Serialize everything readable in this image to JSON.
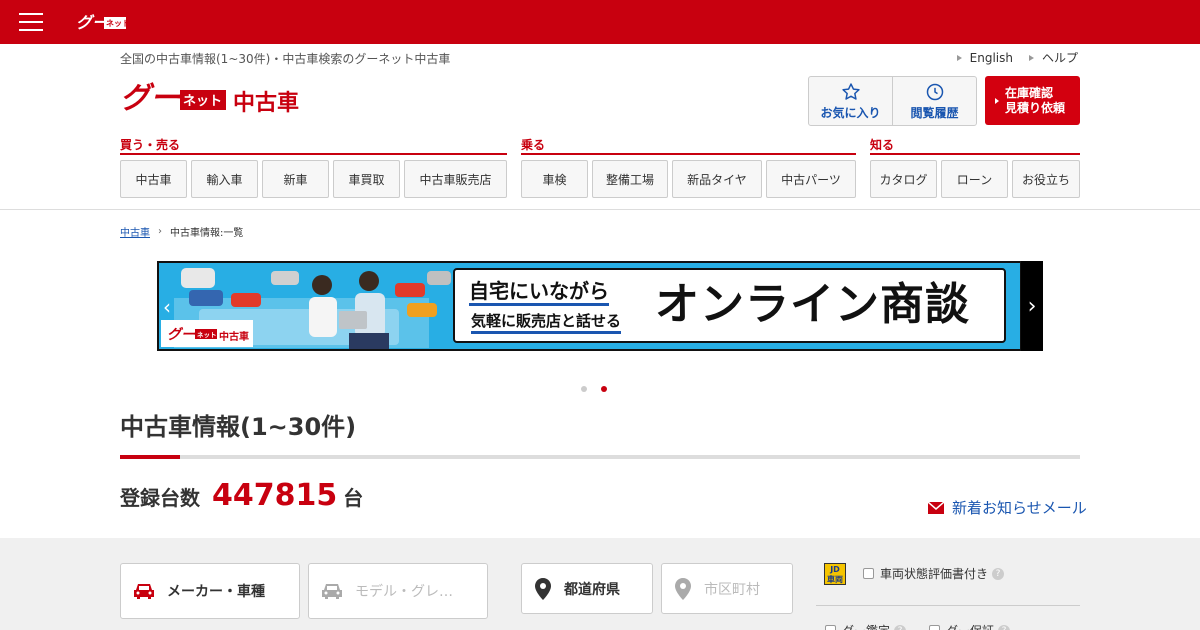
{
  "header": {
    "tagline": "全国の中古車情報(1~30件)・中古車検索のグーネット中古車",
    "links": [
      "English",
      "ヘルプ"
    ],
    "favorites_label": "お気に入り",
    "history_label": "閲覧履歴",
    "stock_line1": "在庫確認",
    "stock_line2": "見積り依頼",
    "logo_text": "グー",
    "logo_net": "ネット",
    "logo_sub": "中古車"
  },
  "nav": [
    {
      "title": "買う・売る",
      "items": [
        "中古車",
        "輸入車",
        "新車",
        "車買取",
        "中古車販売店"
      ]
    },
    {
      "title": "乗る",
      "items": [
        "車検",
        "整備工場",
        "新品タイヤ",
        "中古パーツ"
      ]
    },
    {
      "title": "知る",
      "items": [
        "カタログ",
        "ローン",
        "お役立ち"
      ]
    }
  ],
  "breadcrumb": {
    "home": "中古車",
    "current": "中古車情報:一覧"
  },
  "banner": {
    "sub1": "自宅にいながら",
    "sub2": "気軽に販売店と話せる",
    "main": "オンライン商談",
    "logo_sub": "中古車"
  },
  "carousel": {
    "count": 2,
    "active": 2
  },
  "page": {
    "title": "中古車情報(1~30件)",
    "count_label": "登録台数",
    "count_value": "447815",
    "count_unit": "台",
    "mail_link": "新着お知らせメール"
  },
  "search": {
    "maker_label": "メーカー・車種",
    "model_label": "モデル・グレ…",
    "pref_label": "都道府県",
    "city_label": "市区町村",
    "condition_label": "車両状態評価書付き",
    "goo_appraisal": "グー鑑定",
    "goo_warranty": "グー保証"
  },
  "colors": {
    "brand_red": "#c8000f",
    "link_blue": "#1a56b0",
    "banner_blue": "#28aee4"
  }
}
